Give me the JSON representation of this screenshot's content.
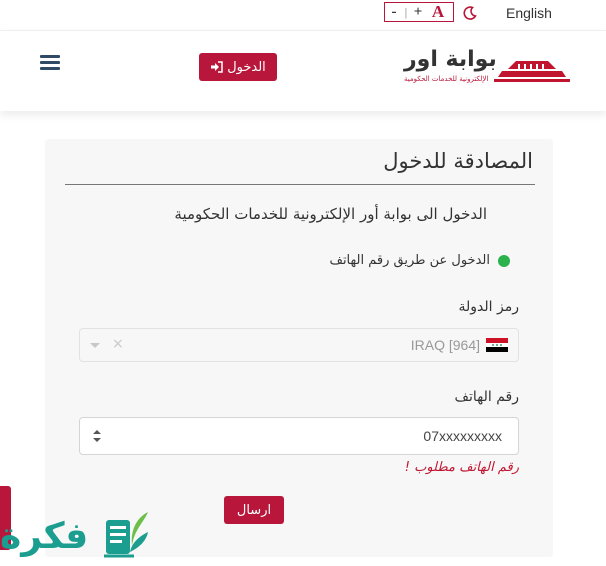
{
  "topbar": {
    "language_link": "English",
    "theme_icon": "moon-icon",
    "font_controls": {
      "decrease": "-",
      "separator": "|",
      "increase": "+",
      "font_letter": "A"
    }
  },
  "header": {
    "brand_title": "بوابة اور",
    "brand_subtitle": "الإلكترونية للخدمات الحكومية",
    "login_button": "الدخول",
    "menu_icon": "hamburger-icon"
  },
  "card": {
    "title": "المصادقة للدخول",
    "subtitle": "الدخول الى بوابة أور الإلكترونية للخدمات الحكومية",
    "method_label": "الدخول عن طريق رقم الهاتف",
    "country_label": "رمز الدولة",
    "country_value": "IRAQ [964]",
    "phone_label": "رقم الهاتف",
    "phone_value": "07xxxxxxxxx",
    "error_text": "رقم الهاتف مطلوب !",
    "send_button": "ارسال"
  },
  "watermark": {
    "text": "فكرة"
  },
  "colors": {
    "brand_red": "#b8173b",
    "success_green": "#2bb24c",
    "watermark_teal": "#1b9e8f"
  }
}
